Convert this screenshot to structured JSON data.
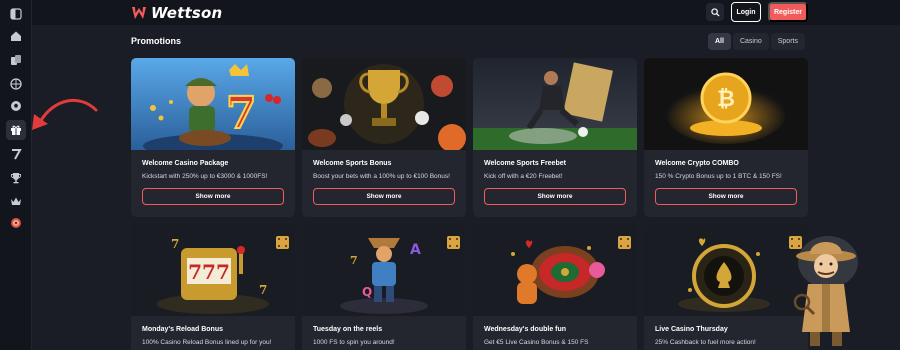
{
  "header": {
    "brand": "Wettson",
    "login_label": "Login",
    "register_label": "Register"
  },
  "sidebar": {
    "items": [
      {
        "icon": "panel-toggle-icon"
      },
      {
        "icon": "home-icon"
      },
      {
        "icon": "cards-icon"
      },
      {
        "icon": "sports-ball-icon"
      },
      {
        "icon": "soccer-ball-icon"
      },
      {
        "icon": "gift-icon",
        "active": true
      },
      {
        "icon": "seven-icon"
      },
      {
        "icon": "trophy-icon"
      },
      {
        "icon": "crown-icon"
      },
      {
        "icon": "wheel-icon"
      }
    ]
  },
  "page": {
    "title": "Promotions",
    "filters": [
      "All",
      "Casino",
      "Sports"
    ],
    "active_filter": "All"
  },
  "promotions": [
    {
      "name": "Welcome Casino Package",
      "desc": "Kickstart with 250% up to €3000 & 1000FS!",
      "button": "Show more"
    },
    {
      "name": "Welcome Sports Bonus",
      "desc": "Boost your bets with a 100% up to €100 Bonus!",
      "button": "Show more"
    },
    {
      "name": "Welcome Sports Freebet",
      "desc": "Kick off with a €20 Freebet!",
      "button": "Show more"
    },
    {
      "name": "Welcome Crypto COMBO",
      "desc": "150 % Crypto Bonus up to 1 BTC & 150 FS!",
      "button": "Show more"
    },
    {
      "name": "Monday's Reload Bonus",
      "desc": "100% Casino Reload Bonus lined up for you!"
    },
    {
      "name": "Tuesday on the reels",
      "desc": "1000 FS to spin you around!"
    },
    {
      "name": "Wednesday's double fun",
      "desc": "Get €5 Live Casino Bonus & 150 FS"
    },
    {
      "name": "Live Casino Thursday",
      "desc": "25% Cashback to fuel more action!"
    }
  ],
  "colors": {
    "accent": "#f15b5b",
    "page_bg": "#1b1d26",
    "card_bg": "#23262f",
    "sidebar_bg": "#13151c"
  }
}
